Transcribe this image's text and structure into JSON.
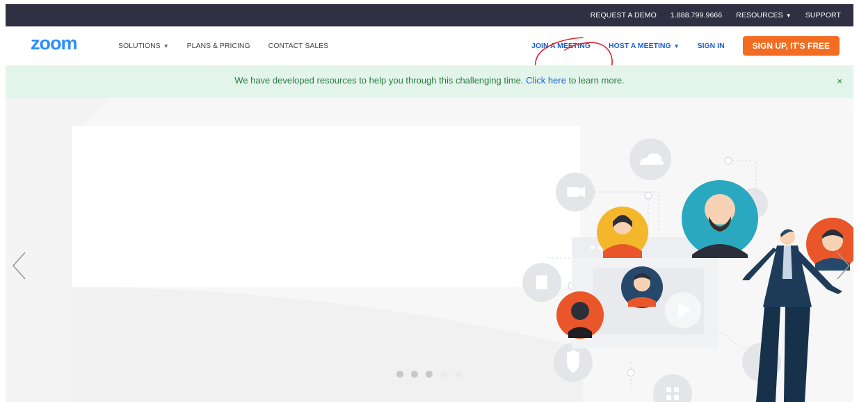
{
  "topbar": {
    "links": [
      "REQUEST A DEMO",
      "1.888.799.9666",
      "RESOURCES",
      "SUPPORT"
    ]
  },
  "nav": {
    "logo": "zoom",
    "left": [
      "SOLUTIONS",
      "PLANS & PRICING",
      "CONTACT SALES"
    ],
    "join": "JOIN A MEETING",
    "host": "HOST A MEETING",
    "signin": "SIGN IN",
    "signup": "SIGN UP, IT'S FREE"
  },
  "banner": {
    "before": "We have developed resources to help you through this challenging time.",
    "link": "Click here",
    "after": "to learn more.",
    "close": "×"
  },
  "carousel": {
    "total_dots": 5,
    "active_dot": 1
  },
  "colors": {
    "topbar_bg": "#2f3142",
    "brand_blue": "#2d8cff",
    "link_blue": "#1a5fd1",
    "cta_orange": "#f26d21",
    "banner_bg": "#e3f5eb",
    "annotation_red": "#d7282f"
  }
}
